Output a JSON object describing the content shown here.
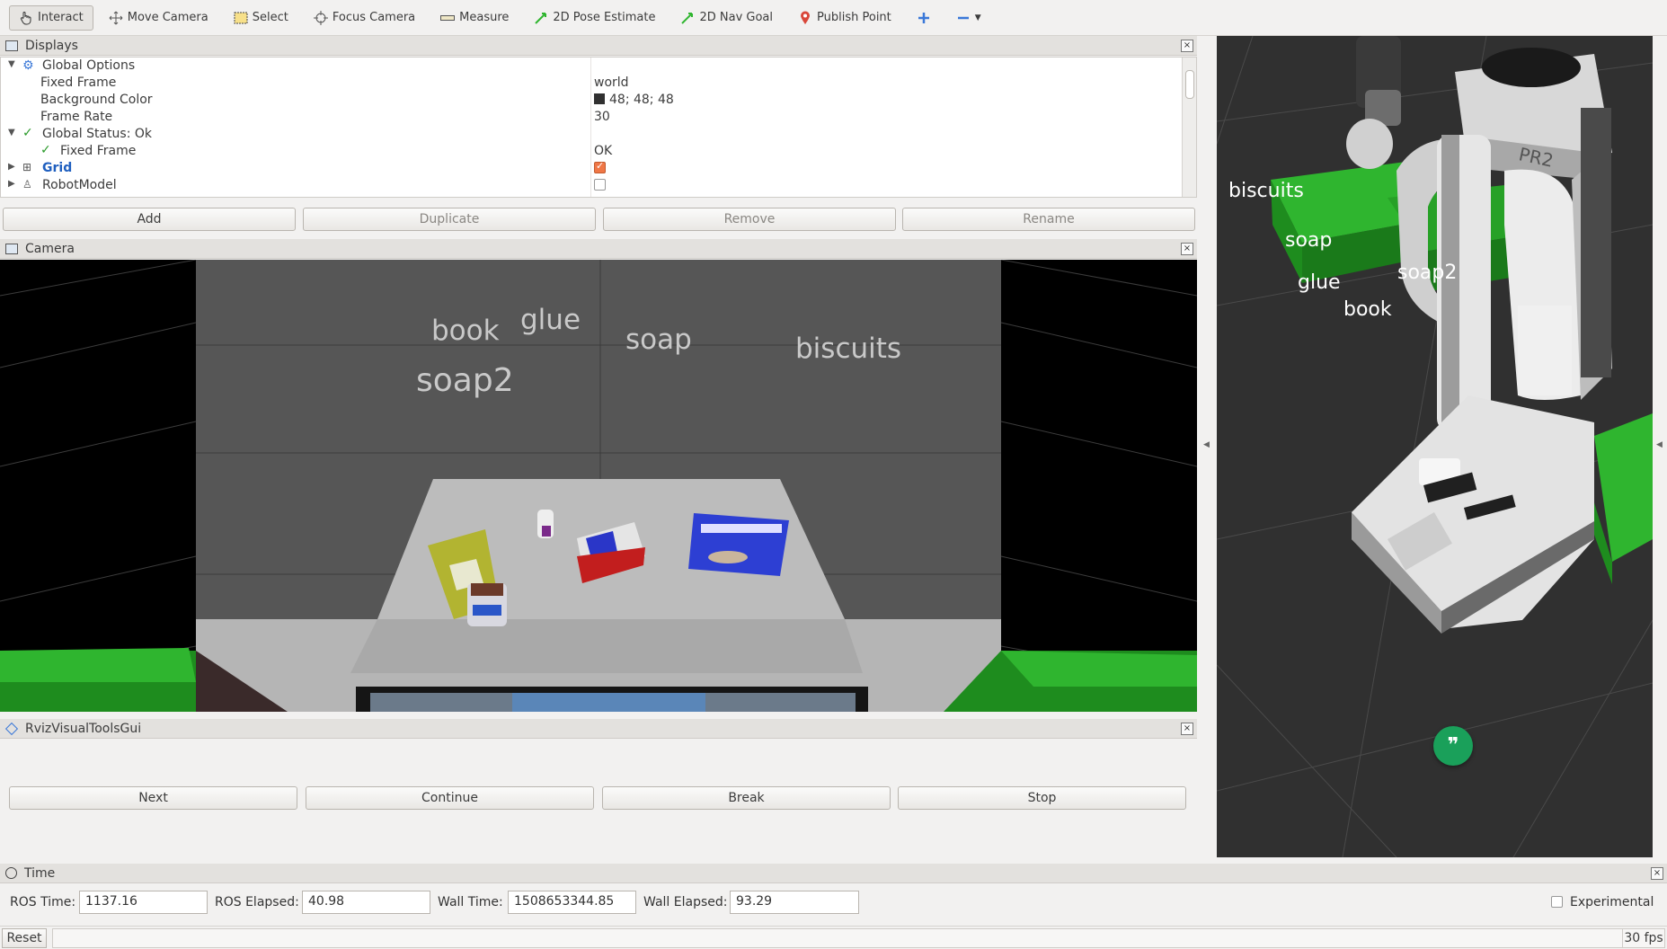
{
  "toolbar": {
    "tools": [
      {
        "label": "Interact",
        "icon": "hand-cursor-icon"
      },
      {
        "label": "Move Camera",
        "icon": "move-camera-icon"
      },
      {
        "label": "Select",
        "icon": "select-rect-icon"
      },
      {
        "label": "Focus Camera",
        "icon": "focus-target-icon"
      },
      {
        "label": "Measure",
        "icon": "ruler-icon"
      },
      {
        "label": "2D Pose Estimate",
        "icon": "green-arrow-icon"
      },
      {
        "label": "2D Nav Goal",
        "icon": "green-arrow-icon"
      },
      {
        "label": "Publish Point",
        "icon": "map-pin-icon"
      }
    ],
    "active": "Interact"
  },
  "displays": {
    "title": "Displays",
    "rows": [
      {
        "label": "Global Options",
        "value": ""
      },
      {
        "label": "Fixed Frame",
        "value": "world"
      },
      {
        "label": "Background Color",
        "value": "48; 48; 48"
      },
      {
        "label": "Frame Rate",
        "value": "30"
      },
      {
        "label": "Global Status: Ok",
        "value": ""
      },
      {
        "label": "Fixed Frame",
        "value": "OK"
      },
      {
        "label": "Grid",
        "value": ""
      },
      {
        "label": "RobotModel",
        "value": ""
      }
    ],
    "buttons": {
      "add": "Add",
      "duplicate": "Duplicate",
      "remove": "Remove",
      "rename": "Rename"
    }
  },
  "camera": {
    "title": "Camera",
    "labels": {
      "book": "book",
      "glue": "glue",
      "soap": "soap",
      "biscuits": "biscuits",
      "soap2": "soap2"
    }
  },
  "view3d": {
    "labels": {
      "biscuits": "biscuits",
      "soap": "soap",
      "glue": "glue",
      "soap2": "soap2",
      "book": "book"
    },
    "robot_badge": "PR2"
  },
  "rviz_tools": {
    "title": "RvizVisualToolsGui",
    "buttons": {
      "next": "Next",
      "continue": "Continue",
      "break": "Break",
      "stop": "Stop"
    }
  },
  "time": {
    "title": "Time",
    "ros_time_label": "ROS Time:",
    "ros_time": "1137.16",
    "ros_elapsed_label": "ROS Elapsed:",
    "ros_elapsed": "40.98",
    "wall_time_label": "Wall Time:",
    "wall_time": "1508653344.85",
    "wall_elapsed_label": "Wall Elapsed:",
    "wall_elapsed": "93.29",
    "experimental_label": "Experimental"
  },
  "status": {
    "reset": "Reset",
    "fps": "30 fps"
  },
  "colors": {
    "background": "#303030",
    "accent_green": "#1aa05a",
    "link_blue": "#1f5fbf"
  }
}
